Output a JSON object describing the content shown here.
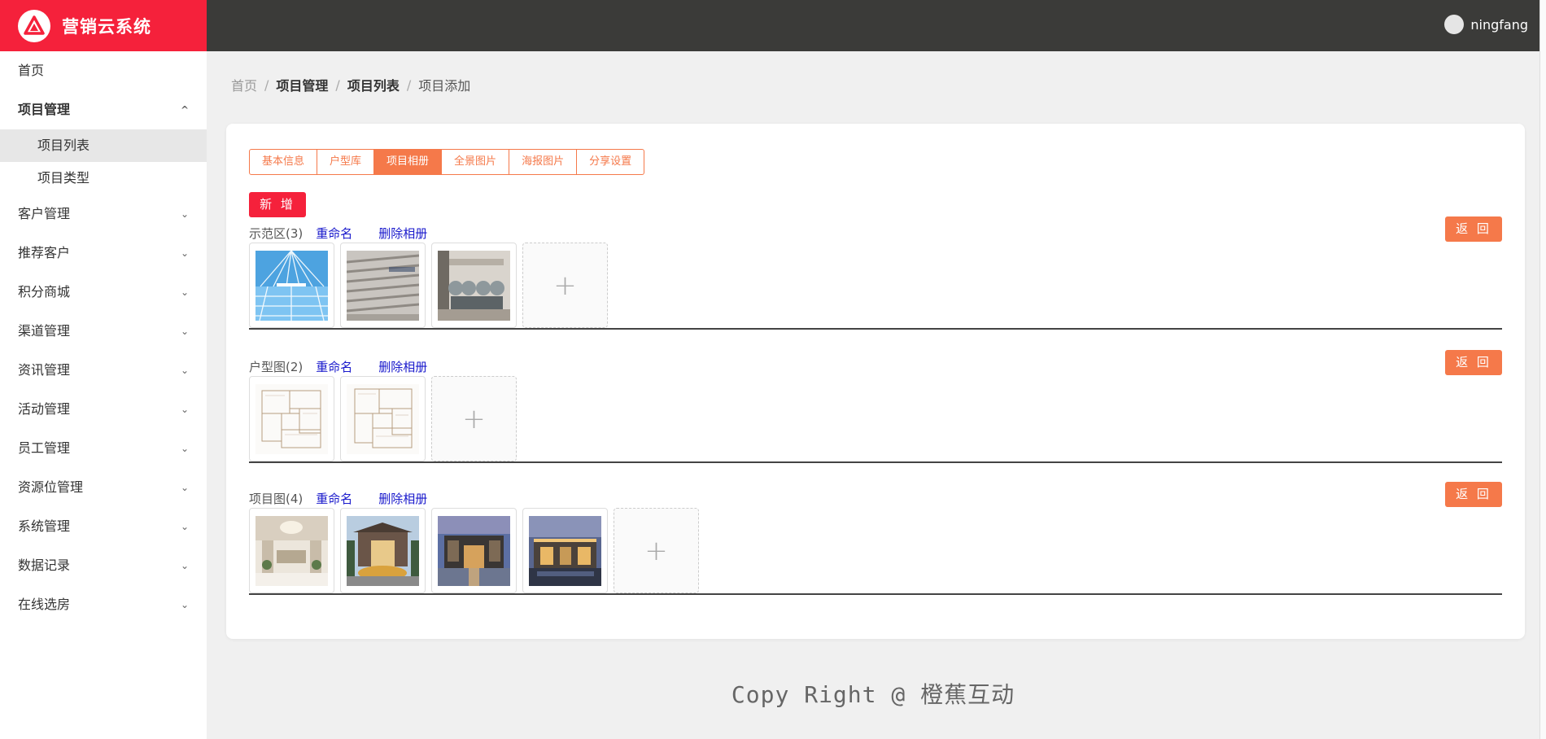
{
  "app": {
    "title": "营销云系统",
    "user": "ningfang"
  },
  "sidebar": {
    "items": [
      {
        "label": "首页",
        "chevron": ""
      },
      {
        "label": "项目管理",
        "chevron": "^"
      },
      {
        "label": "客户管理",
        "chevron": "⌄"
      },
      {
        "label": "推荐客户",
        "chevron": "⌄"
      },
      {
        "label": "积分商城",
        "chevron": "⌄"
      },
      {
        "label": "渠道管理",
        "chevron": "⌄"
      },
      {
        "label": "资讯管理",
        "chevron": "⌄"
      },
      {
        "label": "活动管理",
        "chevron": "⌄"
      },
      {
        "label": "员工管理",
        "chevron": "⌄"
      },
      {
        "label": "资源位管理",
        "chevron": "⌄"
      },
      {
        "label": "系统管理",
        "chevron": "⌄"
      },
      {
        "label": "数据记录",
        "chevron": "⌄"
      },
      {
        "label": "在线选房",
        "chevron": "⌄"
      }
    ],
    "subitems": [
      "项目列表",
      "项目类型"
    ],
    "active_subitem": "项目列表"
  },
  "breadcrumb": {
    "items": [
      "首页",
      "项目管理",
      "项目列表",
      "项目添加"
    ],
    "separator": "/"
  },
  "tabs": [
    "基本信息",
    "户型库",
    "项目相册",
    "全景图片",
    "海报图片",
    "分享设置"
  ],
  "active_tab": "项目相册",
  "add_button": "新 增",
  "albums": [
    {
      "name": "示范区(3)",
      "rename": "重命名",
      "delete": "删除相册",
      "back": "返 回",
      "photos": [
        "pool",
        "gallery-wall",
        "lounge"
      ]
    },
    {
      "name": "户型图(2)",
      "rename": "重命名",
      "delete": "删除相册",
      "back": "返 回",
      "photos": [
        "floorplan",
        "floorplan"
      ]
    },
    {
      "name": "项目图(4)",
      "rename": "重命名",
      "delete": "删除相册",
      "back": "返 回",
      "photos": [
        "lobby",
        "entrance-fountain",
        "facade-night",
        "exterior-dusk"
      ]
    }
  ],
  "upload_icon": "+",
  "footer": "Copy Right @ 橙蕉互动",
  "colors": {
    "brand_red": "#f5213b",
    "accent_orange": "#f5794a",
    "topbar": "#3b3b39",
    "link_blue": "#1a1acc"
  }
}
